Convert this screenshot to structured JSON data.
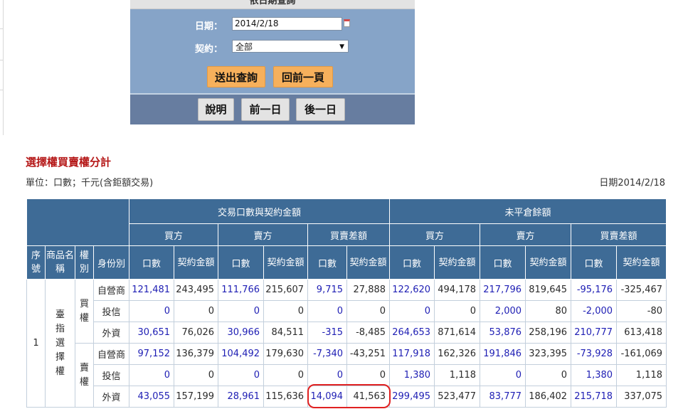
{
  "query_panel": {
    "title": "依日期查詢",
    "date_label": "日期：",
    "date_value": "2014/2/18",
    "contract_label": "契約：",
    "contract_selected": "全部",
    "submit_label": "送出查詢",
    "back_label": "回前一頁",
    "help_label": "說明",
    "prev_day_label": "前一日",
    "next_day_label": "後一日"
  },
  "report": {
    "title": "選擇權買賣權分計",
    "unit": "單位：口數；千元(含鉅額交易)",
    "date": "日期2014/2/18"
  },
  "table": {
    "group_headers": [
      "交易口數與契約金額",
      "未平倉餘額"
    ],
    "side_headers": [
      "買方",
      "賣方",
      "買賣差額",
      "買方",
      "賣方",
      "買賣差額"
    ],
    "col_seq": "序號",
    "col_product": "商品名稱",
    "col_right": "權別",
    "col_identity": "身份別",
    "col_qty": "口數",
    "col_amount": "契約金額",
    "seq": "1",
    "product": "臺指選擇權",
    "call_label": "買權",
    "put_label": "賣權",
    "rows": [
      {
        "identity": "自營商",
        "cells": [
          "121,481",
          "243,495",
          "111,766",
          "215,607",
          "9,715",
          "27,888",
          "122,620",
          "494,178",
          "217,796",
          "819,645",
          "-95,176",
          "-325,467"
        ]
      },
      {
        "identity": "投信",
        "cells": [
          "0",
          "0",
          "0",
          "0",
          "0",
          "0",
          "0",
          "0",
          "2,000",
          "80",
          "-2,000",
          "-80"
        ]
      },
      {
        "identity": "外資",
        "cells": [
          "30,651",
          "76,026",
          "30,966",
          "84,511",
          "-315",
          "-8,485",
          "264,653",
          "871,614",
          "53,876",
          "258,196",
          "210,777",
          "613,418"
        ]
      },
      {
        "identity": "自營商",
        "cells": [
          "97,152",
          "136,379",
          "104,492",
          "179,630",
          "-7,340",
          "-43,251",
          "117,918",
          "162,326",
          "191,846",
          "323,395",
          "-73,928",
          "-161,069"
        ]
      },
      {
        "identity": "投信",
        "cells": [
          "0",
          "0",
          "0",
          "0",
          "0",
          "0",
          "1,380",
          "1,118",
          "0",
          "0",
          "1,380",
          "1,118"
        ]
      },
      {
        "identity": "外資",
        "cells": [
          "43,055",
          "157,199",
          "28,961",
          "115,636",
          "14,094",
          "41,563",
          "299,495",
          "523,477",
          "83,777",
          "186,402",
          "215,718",
          "337,075"
        ]
      }
    ]
  }
}
